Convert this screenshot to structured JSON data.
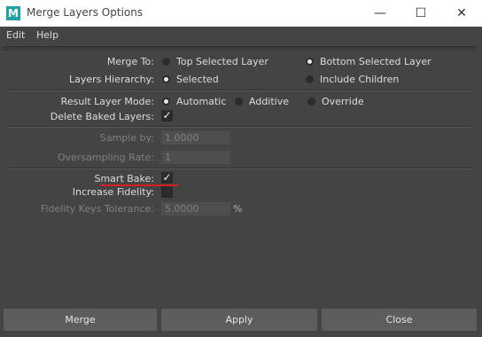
{
  "window": {
    "title": "Merge Layers Options",
    "app_logo": "M",
    "minimize_glyph": "—",
    "maximize_glyph": "☐",
    "close_glyph": "✕"
  },
  "menu": {
    "items": [
      "Edit",
      "Help"
    ]
  },
  "form": {
    "merge_to": {
      "label": "Merge To:",
      "options": [
        "Top Selected Layer",
        "Bottom Selected Layer"
      ],
      "selected": "Bottom Selected Layer"
    },
    "layers_hierarchy": {
      "label": "Layers Hierarchy:",
      "options": [
        "Selected",
        "Include Children"
      ],
      "selected": "Selected"
    },
    "result_layer_mode": {
      "label": "Result Layer Mode:",
      "options": [
        "Automatic",
        "Additive",
        "Override"
      ],
      "selected": "Automatic"
    },
    "delete_baked_layers": {
      "label": "Delete Baked Layers:",
      "checked": true
    },
    "sample_by": {
      "label": "Sample by:",
      "value": "1.0000",
      "enabled": false
    },
    "oversampling_rate": {
      "label": "Oversampling Rate:",
      "value": "1",
      "enabled": false
    },
    "smart_bake": {
      "label": "Smart Bake:",
      "checked": true
    },
    "increase_fidelity": {
      "label": "Increase Fidelity:",
      "checked": false
    },
    "fidelity_keys_tolerance": {
      "label": "Fidelity Keys Tolerance:",
      "value": "5.0000",
      "unit": "%",
      "enabled": false
    }
  },
  "buttons": {
    "merge": "Merge",
    "apply": "Apply",
    "close": "Close"
  },
  "colors": {
    "background": "#444444",
    "annotation_underline": "#d61f1f",
    "logo": "#1fa2a6"
  },
  "check_glyph": "✓"
}
